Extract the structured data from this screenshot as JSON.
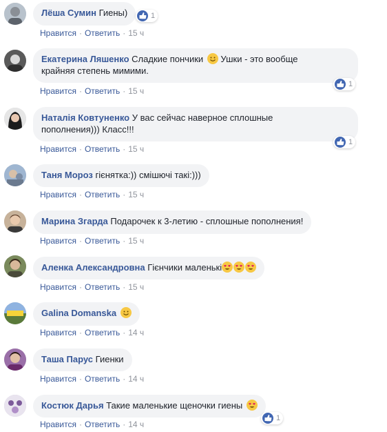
{
  "actions": {
    "like": "Нравится",
    "reply": "Ответить",
    "sep": "·"
  },
  "comments": [
    {
      "author": "Лёша Сумин",
      "text": "Гиены)",
      "time": "15 ч",
      "reactions": "1"
    },
    {
      "author": "Екатерина Ляшенко",
      "text": "Сладкие пончики",
      "text2": "Ушки - это вообще",
      "text3": "крайняя степень мимими.",
      "time": "15 ч",
      "reactions": "1"
    },
    {
      "author": "Наталія Ковтуненко",
      "text": "У вас сейчас наверное сплошные",
      "text2": "пополнения))) Класс!!!",
      "time": "15 ч",
      "reactions": "1"
    },
    {
      "author": "Таня Мороз",
      "text": "гієнятка:)) смішючі такі:)))",
      "time": "15 ч"
    },
    {
      "author": "Марина Згарда",
      "text": "Подарочек к 3-летию - сплошные пополнения!",
      "time": "15 ч"
    },
    {
      "author": "Аленка Александровна",
      "text": "Гієнчики маленькі",
      "time": "15 ч"
    },
    {
      "author": "Galina Domanska",
      "text": "",
      "time": "14 ч"
    },
    {
      "author": "Таша Парус",
      "text": "Гиенки",
      "time": "14 ч"
    },
    {
      "author": "Костюк Дарья",
      "text": "Такие маленькие щеночки гиены",
      "time": "14 ч",
      "reactions": "1"
    }
  ],
  "colors": {
    "author": "#385898",
    "bubble": "#f2f3f5",
    "meta": "#90949c",
    "like": "#4267b2"
  },
  "icons": {
    "like": "thumbs-up-icon",
    "love": "heart-eyes-emoji",
    "smile": "smile-emoji"
  }
}
